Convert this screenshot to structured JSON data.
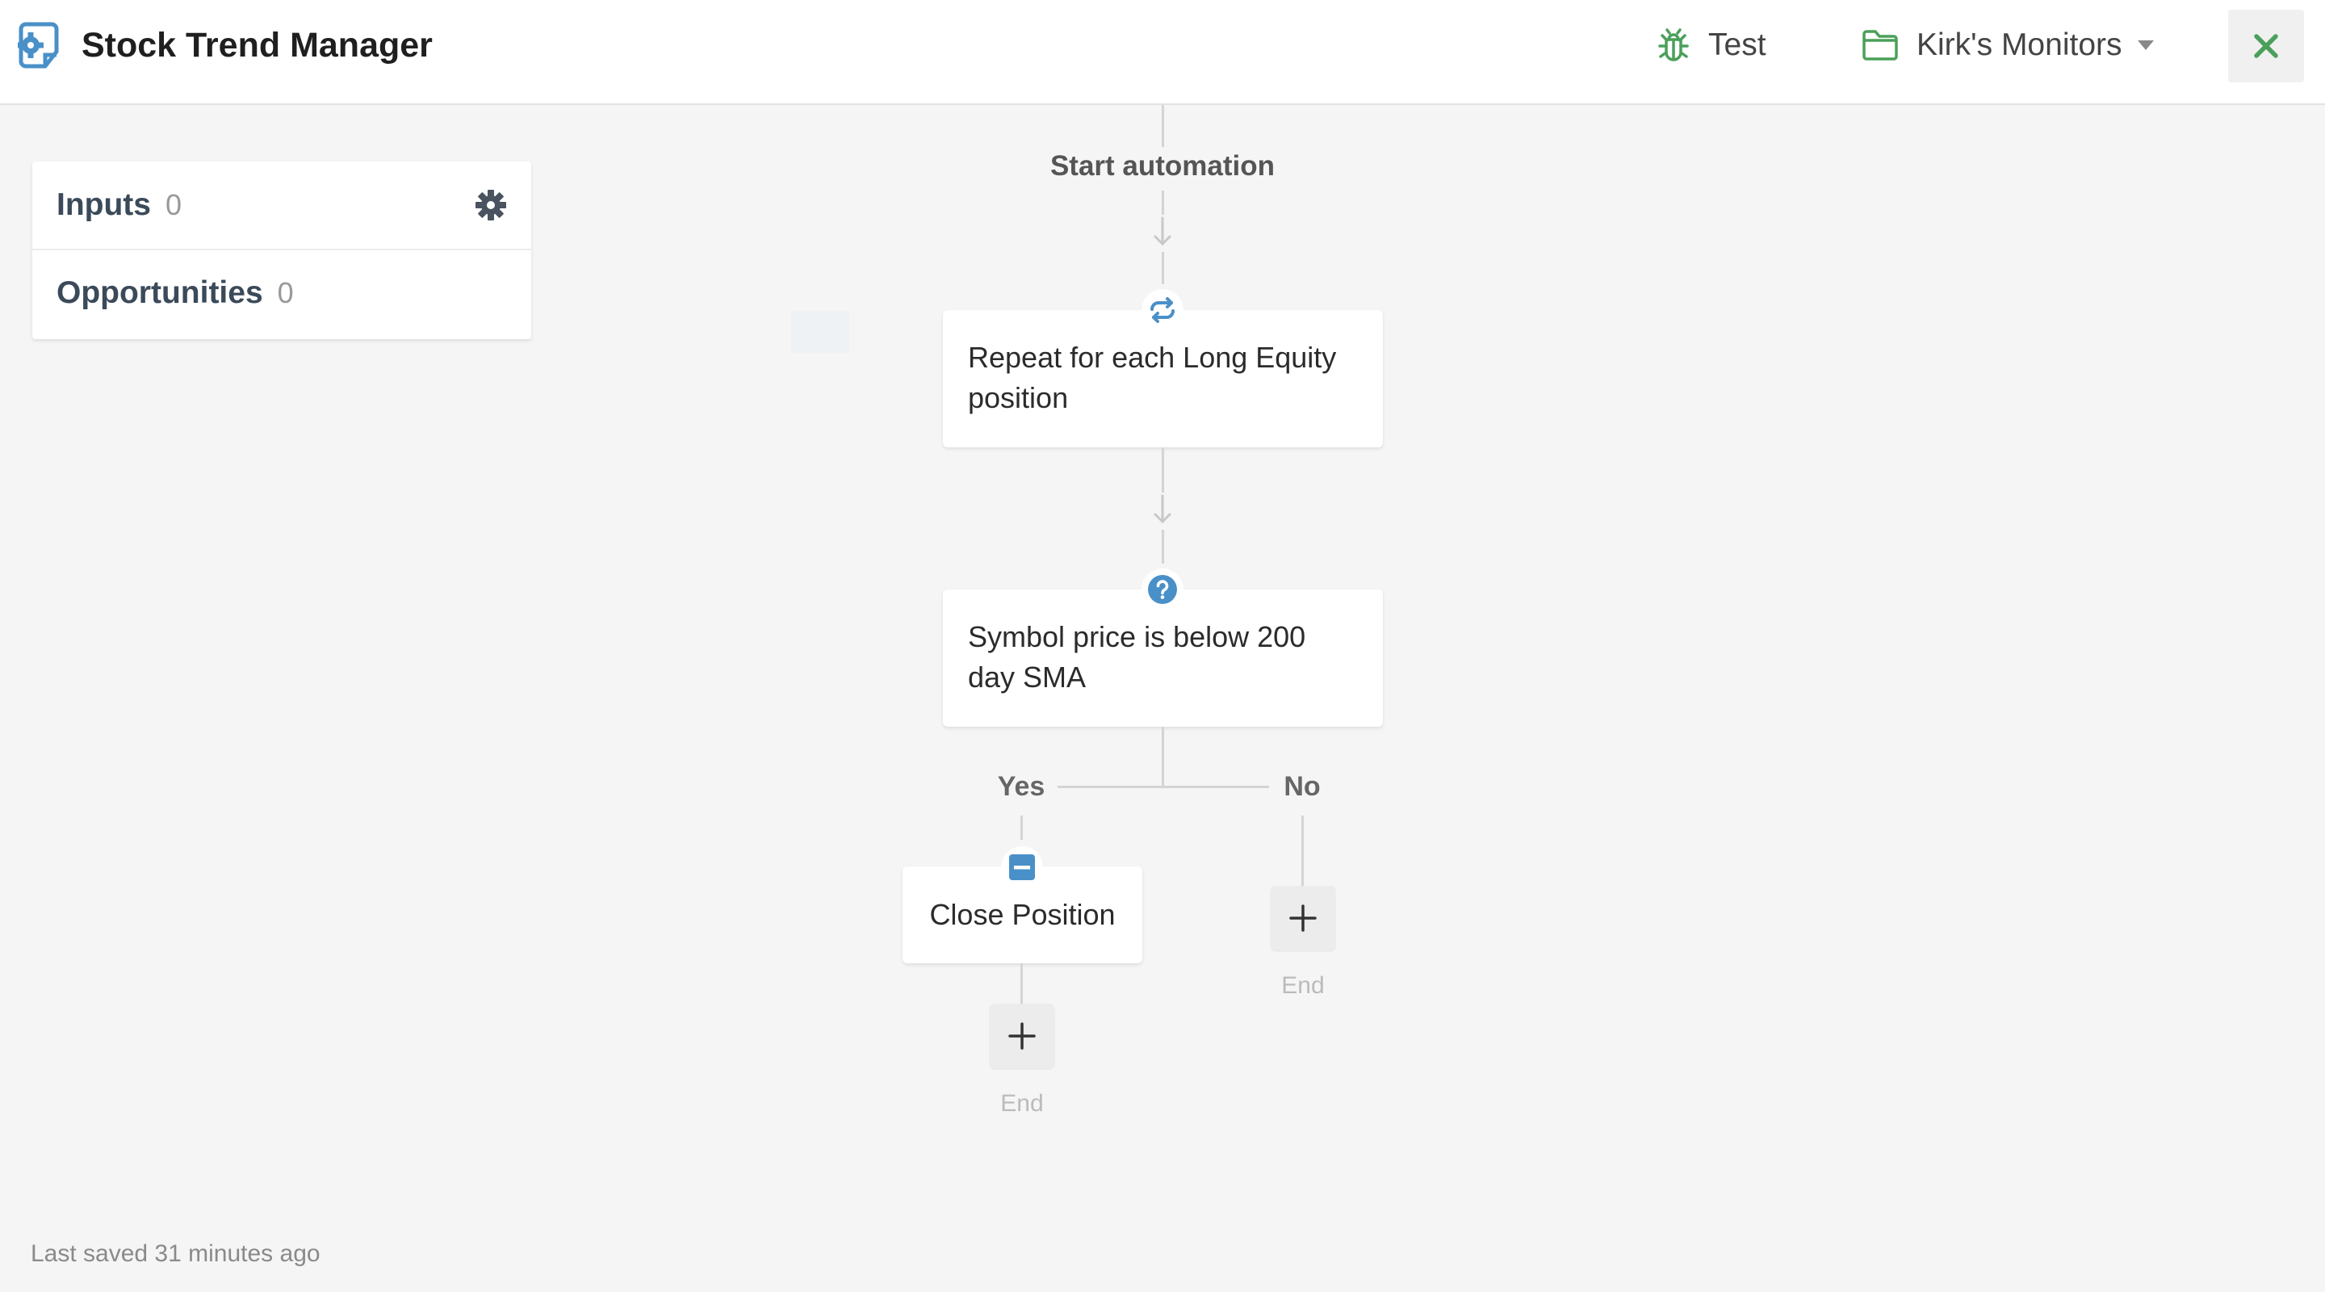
{
  "header": {
    "title": "Stock Trend Manager",
    "test_label": "Test",
    "folder_label": "Kirk's Monitors",
    "close_label": "Close",
    "icons": {
      "logo": "automation-gear-icon",
      "test": "bug-icon",
      "folder": "folder-icon",
      "dropdown": "chevron-down-icon",
      "close": "close-icon"
    }
  },
  "side_panel": {
    "items": [
      {
        "label": "Inputs",
        "count": "0",
        "icon": "gear-icon"
      },
      {
        "label": "Opportunities",
        "count": "0"
      }
    ]
  },
  "flow": {
    "start_label": "Start automation",
    "nodes": [
      {
        "type": "loop",
        "icon": "repeat-icon",
        "text_line1": "Repeat for each Long Equity",
        "text_line2": "position"
      },
      {
        "type": "condition",
        "icon": "question-icon",
        "text_line1": "Symbol price is below 200",
        "text_line2": "day SMA"
      },
      {
        "type": "action",
        "icon": "minus-square-icon",
        "text": "Close Position"
      }
    ],
    "branches": {
      "yes_label": "Yes",
      "no_label": "No"
    },
    "end_label": "End",
    "add_icon": "plus-icon"
  },
  "footer": {
    "status": "Last saved 31 minutes ago"
  },
  "colors": {
    "accent_green": "#4aa05a",
    "accent_blue": "#4a90c8",
    "background": "#f5f5f5"
  }
}
